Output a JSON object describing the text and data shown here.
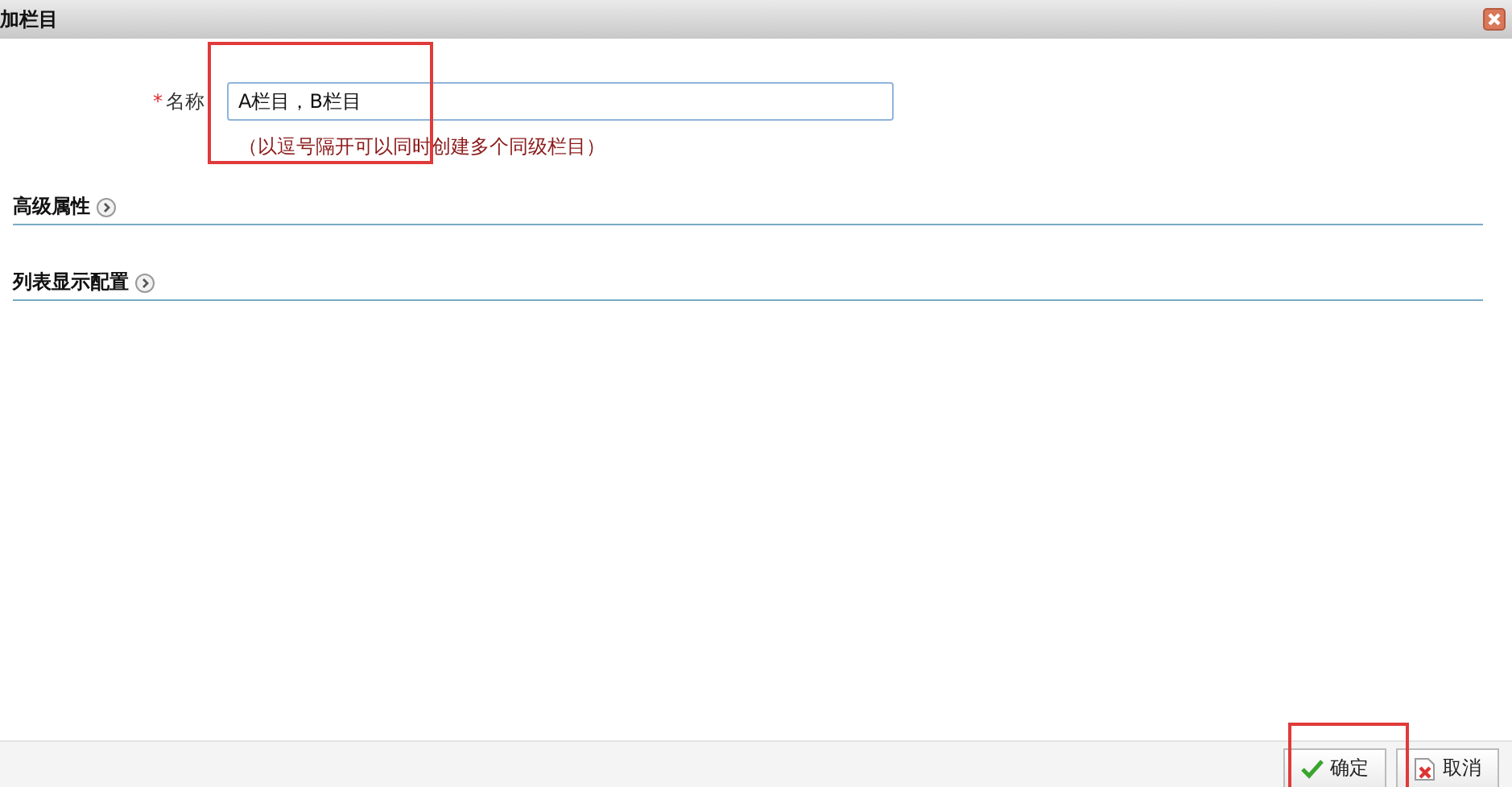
{
  "window": {
    "title": "加栏目"
  },
  "form": {
    "label": "名称",
    "required_mark": "*",
    "value": "A栏目，B栏目",
    "hint": "（以逗号隔开可以同时创建多个同级栏目）",
    "highlighted": true
  },
  "sections": [
    {
      "title": "高级属性",
      "expanded": false
    },
    {
      "title": "列表显示配置",
      "expanded": false
    }
  ],
  "buttons": [
    {
      "kind": "confirm",
      "label": "确定",
      "highlighted": true
    },
    {
      "kind": "cancel",
      "label": "取消",
      "highlighted": false
    }
  ]
}
